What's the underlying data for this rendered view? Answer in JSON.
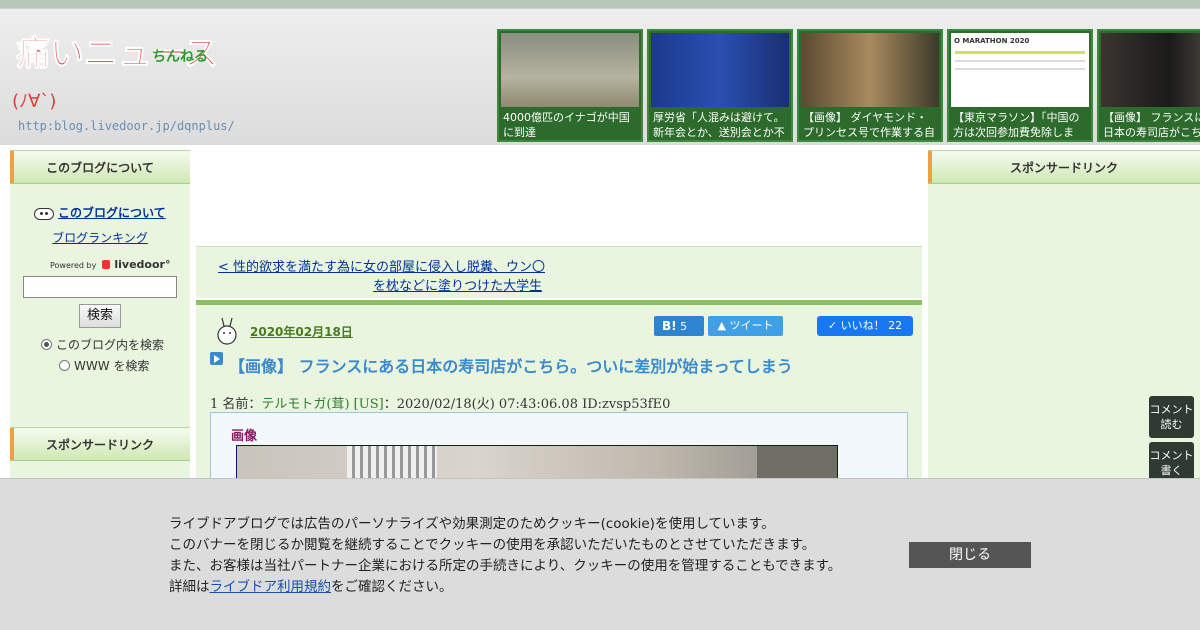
{
  "header": {
    "logo_main": "痛いニュース",
    "logo_sub": "ちんねる",
    "logo_face": "(ﾉ∀`)",
    "logo_url": "http:blog.livedoor.jp/dqnplus/",
    "thumbs": [
      {
        "caption": "4000億匹のイナゴが中国に到達"
      },
      {
        "caption": "厚労省「人混みは避けて。新年会とか、送別会とか不"
      },
      {
        "caption": "【画像】 ダイヤモンド・プリンセス号で作業する自衛"
      },
      {
        "caption": "【東京マラソン】「中国の方は次回参加費免除しま"
      },
      {
        "caption": "【画像】 フランスにある日本の寿司店がこちら"
      }
    ],
    "thumb4_banner": "O MARATHON 2020"
  },
  "left_sidebar": {
    "about_heading": "このブログについて",
    "about_link": "このブログについて",
    "ranking_link": "ブログランキング",
    "powered_by": "Powered by",
    "powered_brand": "livedoor°",
    "search_value": "",
    "search_button": "検索",
    "radio_blog": "このブログ内を検索",
    "radio_www": "WWW を検索",
    "sponsor_heading": "スポンサードリンク"
  },
  "right_sidebar": {
    "sponsor_heading": "スポンサードリンク"
  },
  "main": {
    "prev_line1": "< 性的欲求を満たす為に女の部屋に侵入し脱糞、ウン〇",
    "prev_line2": "を枕などに塗りつけた大学生",
    "date": "2020年02月18日",
    "hatena_label": "B!",
    "hatena_count": "5",
    "tweet_label": "ツイート",
    "like_label": "いいね！",
    "like_count": "22",
    "title": "【画像】 フランスにある日本の寿司店がこちら。ついに差別が始まってしまう",
    "post_prefix": "1 名前：",
    "post_name": "テルモトガ(茸) [US]",
    "post_rest": "：2020/02/18(火) 07:43:06.08 ID:zvsp53fE0",
    "quote_label": "画像"
  },
  "float_buttons": {
    "read": "コメント\n読む",
    "write": "コメント\n書く"
  },
  "cookie": {
    "line1": "ライブドアブログでは広告のパーソナライズや効果測定のためクッキー(cookie)を使用しています。",
    "line2": "このバナーを閉じるか閲覧を継続することでクッキーの使用を承認いただいたものとさせていただきます。",
    "line3": "また、お客様は当社パートナー企業における所定の手続きにより、クッキーの使用を管理することもできます。",
    "line4_prefix": "詳細は",
    "line4_link": "ライブドア利用規約",
    "line4_suffix": "をご確認ください。",
    "close_button": "閉じる"
  },
  "colors": {
    "accent_green": "#8cc060",
    "link_blue": "#003399",
    "title_blue": "#3a8ad0",
    "thumb_bg": "#2d6b2d"
  }
}
